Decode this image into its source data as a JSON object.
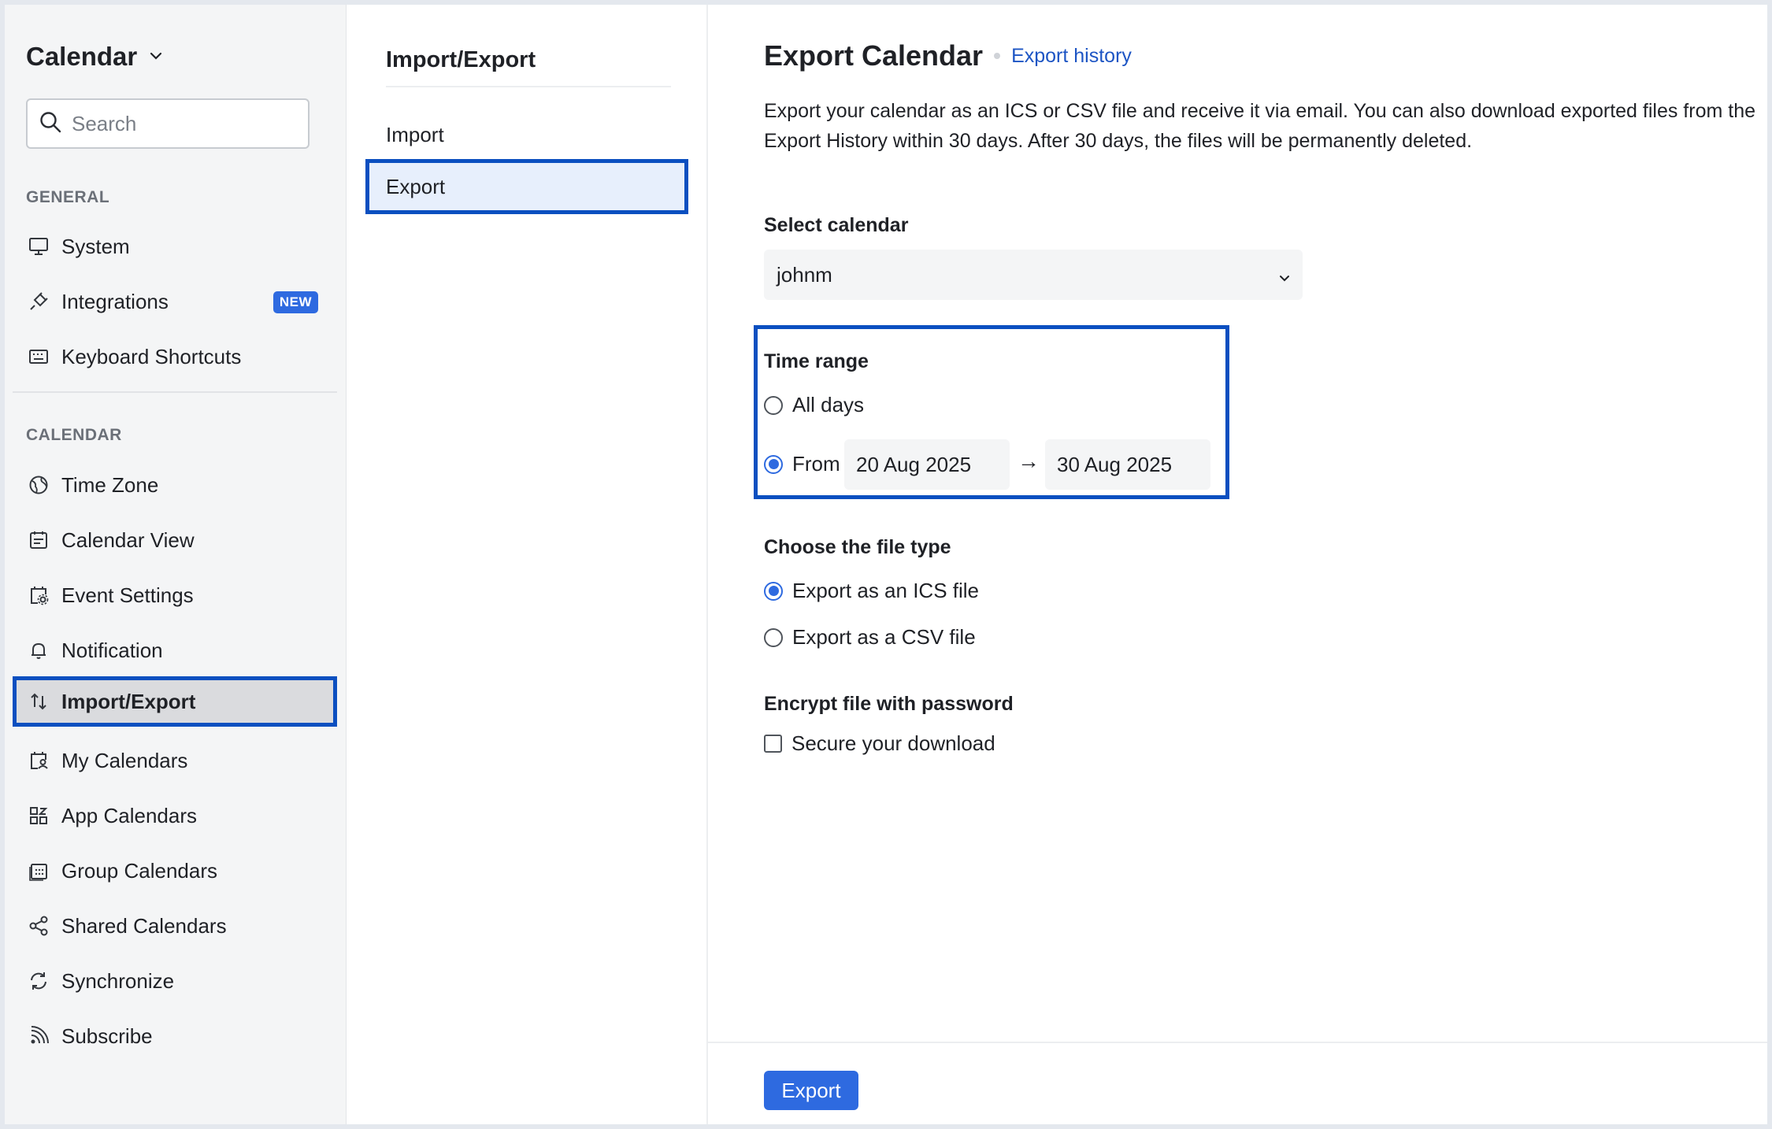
{
  "sidebar": {
    "app_title": "Calendar",
    "search_placeholder": "Search",
    "general_heading": "GENERAL",
    "general_items": [
      {
        "label": "System",
        "icon": "monitor-icon"
      },
      {
        "label": "Integrations",
        "icon": "plug-icon",
        "badge": "NEW"
      },
      {
        "label": "Keyboard Shortcuts",
        "icon": "keyboard-icon"
      }
    ],
    "calendar_heading": "CALENDAR",
    "calendar_items": [
      {
        "label": "Time Zone",
        "icon": "globe-icon"
      },
      {
        "label": "Calendar View",
        "icon": "calendar-view-icon"
      },
      {
        "label": "Event Settings",
        "icon": "event-settings-icon"
      },
      {
        "label": "Notification",
        "icon": "bell-icon"
      },
      {
        "label": "Import/Export",
        "icon": "import-export-icon",
        "active": true
      },
      {
        "label": "My Calendars",
        "icon": "my-calendars-icon"
      },
      {
        "label": "App Calendars",
        "icon": "app-calendars-icon"
      },
      {
        "label": "Group Calendars",
        "icon": "group-calendars-icon"
      },
      {
        "label": "Shared Calendars",
        "icon": "share-icon"
      },
      {
        "label": "Synchronize",
        "icon": "sync-icon"
      },
      {
        "label": "Subscribe",
        "icon": "rss-icon"
      }
    ]
  },
  "middle": {
    "title": "Import/Export",
    "items": [
      {
        "label": "Import"
      },
      {
        "label": "Export",
        "active": true
      }
    ]
  },
  "main": {
    "title": "Export Calendar",
    "history_link": "Export history",
    "description": "Export your calendar as an ICS or CSV file and receive it via email. You can also download exported files from the Export History within 30 days. After 30 days, the files will be permanently deleted.",
    "select_calendar_label": "Select calendar",
    "selected_calendar": "johnm",
    "time_range_label": "Time range",
    "all_days_label": "All days",
    "from_label": "From",
    "from_date": "20 Aug 2025",
    "to_date": "30 Aug 2025",
    "arrow": "→",
    "file_type_label": "Choose the file type",
    "ics_label": "Export as an ICS file",
    "csv_label": "Export as a CSV file",
    "encrypt_label": "Encrypt file with password",
    "secure_label": "Secure your download",
    "export_button": "Export"
  },
  "colors": {
    "accent": "#2e6ae0",
    "highlight_border": "#0b4fc0",
    "link": "#1d55c4"
  }
}
